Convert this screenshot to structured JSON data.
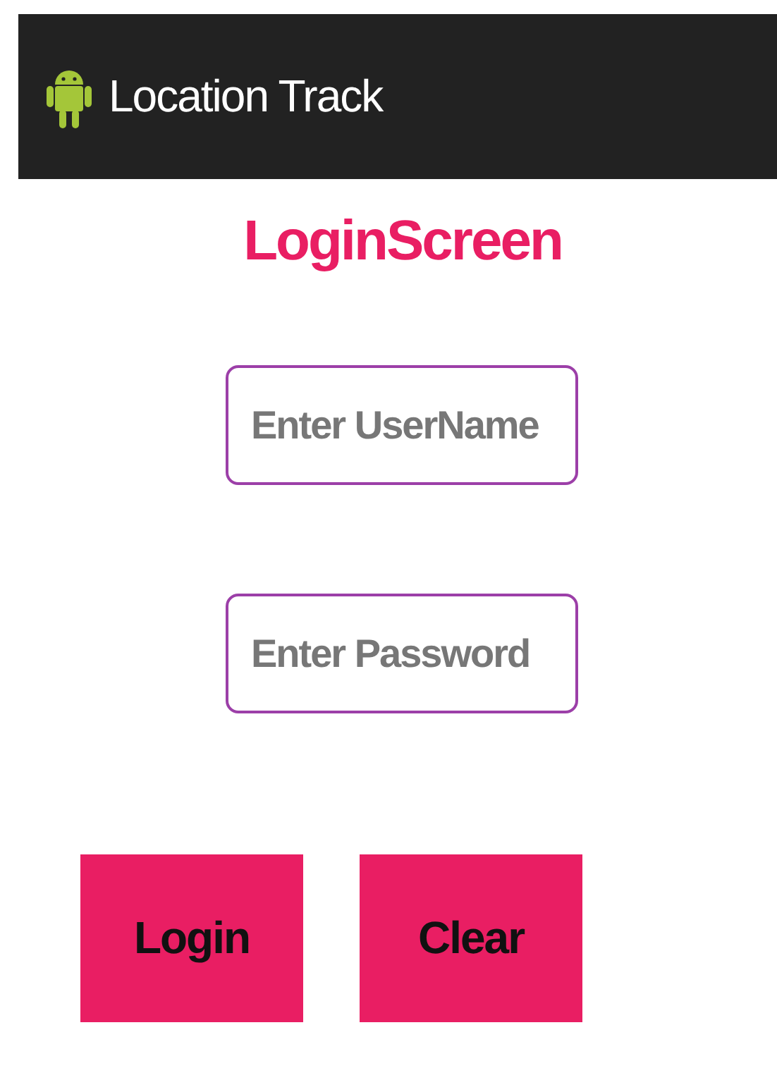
{
  "app_bar": {
    "title": "Location Track"
  },
  "heading": "LoginScreen",
  "fields": [
    {
      "placeholder": "Enter UserName"
    },
    {
      "placeholder": "Enter Password"
    }
  ],
  "buttons": [
    "Login",
    "Clear"
  ]
}
